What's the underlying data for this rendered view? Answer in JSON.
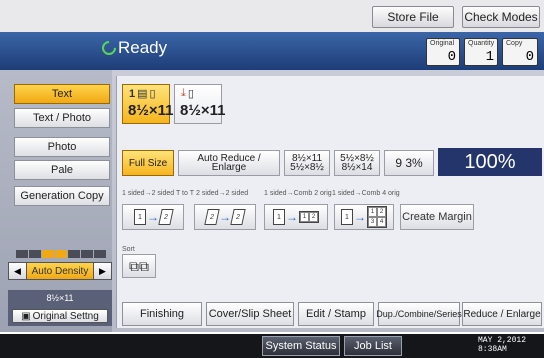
{
  "top": {
    "store_file": "Store File",
    "check_modes": "Check Modes"
  },
  "status": {
    "ready": "Ready",
    "original_label": "Original",
    "original_value": "0",
    "quantity_label": "Quantity",
    "quantity_value": "1",
    "copy_label": "Copy",
    "copy_value": "0"
  },
  "modes": [
    "Text",
    "Text / Photo",
    "Photo",
    "Pale",
    "Generation Copy"
  ],
  "paper": [
    {
      "tray": "1",
      "size": "8½×11"
    },
    {
      "tray": "",
      "size": "8½×11"
    }
  ],
  "reduce": {
    "full_size": "Full Size",
    "auto_reduce": "Auto Reduce / Enlarge",
    "r1_top": "8½×11",
    "r1_bot": "5½×8½",
    "r2_top": "5½×8½",
    "r2_bot": "8½×14",
    "pct93": "9 3%",
    "zoom": "100%"
  },
  "duplex_labels": [
    "1 sided→2 sided T to T",
    "2 sided→2 sided",
    "1 sided→Comb 2 orig",
    "1 sided→Comb 4 orig"
  ],
  "create_margin": "Create Margin",
  "sort_label": "Sort",
  "density": {
    "label": "Auto Density"
  },
  "original_info": {
    "size": "8½×11",
    "setting": "Original Settng"
  },
  "tabs": [
    "Finishing",
    "Cover/Slip Sheet",
    "Edit / Stamp",
    "Dup./Combine/Series",
    "Reduce / Enlarge"
  ],
  "footer": {
    "system_status": "System Status",
    "job_list": "Job List",
    "date_line1": "MAY  2,2012",
    "date_line2": "8:38AM"
  }
}
